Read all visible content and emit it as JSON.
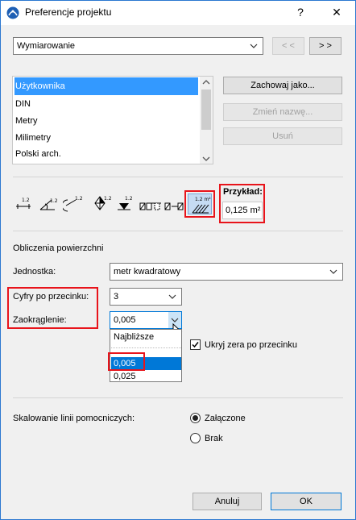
{
  "window": {
    "title": "Preferencje projektu",
    "help_label": "?",
    "close_label": "✕"
  },
  "top": {
    "category": "Wymiarowanie",
    "prev_label": "< <",
    "next_label": "> >"
  },
  "standards": {
    "items": [
      "Użytkownika",
      "DIN",
      "Metry",
      "Milimetry",
      "Polski arch."
    ],
    "selected_index": 0
  },
  "actions": {
    "save_as": "Zachowaj jako...",
    "rename": "Zmień nazwę...",
    "delete": "Usuń"
  },
  "toolbar": {
    "icons": [
      "linear-dimension-icon",
      "angle-dimension-icon",
      "radial-dimension-icon",
      "level-dimension-icon",
      "elevation-dimension-icon",
      "door-window-dimension-icon",
      "sill-height-icon",
      "area-dimension-icon"
    ],
    "superscripts": [
      "1.2",
      "1.2",
      "1.2",
      "1.2",
      "1.2",
      "",
      "",
      "1.2 m²"
    ]
  },
  "preview": {
    "label": "Przykład:",
    "value": "0,125 m²"
  },
  "section": {
    "title": "Obliczenia powierzchni"
  },
  "unit": {
    "label": "Jednostka:",
    "value": "metr kwadratowy"
  },
  "decimals": {
    "label": "Cyfry po przecinku:",
    "value": "3"
  },
  "rounding": {
    "label": "Zaokrąglenie:",
    "value": "0,005",
    "options": [
      "Najbliższe",
      "",
      "0,005",
      "0,025"
    ],
    "highlighted_index": 2
  },
  "hide_zeros": {
    "label": "Ukryj zera po przecinku",
    "checked": true
  },
  "scaling": {
    "label": "Skalowanie linii pomocniczych:",
    "on_label": "Załączone",
    "off_label": "Brak",
    "selected": "on"
  },
  "footer": {
    "cancel": "Anuluj",
    "ok": "OK"
  },
  "colors": {
    "accent": "#3399ff",
    "highlight": "#e8141b"
  }
}
